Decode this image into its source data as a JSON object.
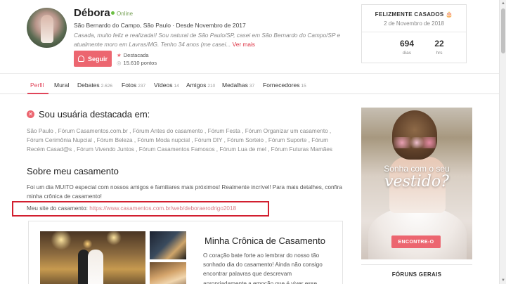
{
  "profile": {
    "name": "Débora",
    "status": "Online",
    "location": "São Bernardo do Campo, São Paulo · Desde Novembro de 2017",
    "bio": "Casada, muito feliz e realizada!! Sou natural de São Paulo/SP, casei em São Bernardo do Campo/SP e atualmente moro em Lavras/MG. Tenho 34 anos (me casei... ",
    "bio_more": "Ver mais",
    "follow_label": "Seguir",
    "featured_label": "Destacada",
    "points_label": "15.610 pontos"
  },
  "married_card": {
    "title": "FELIZMENTE CASADOS",
    "date": "2 de Novembro de 2018",
    "days_value": "694",
    "days_label": "dias",
    "hours_value": "22",
    "hours_label": "hrs"
  },
  "tabs": [
    {
      "label": "Perfil",
      "count": ""
    },
    {
      "label": "Mural",
      "count": ""
    },
    {
      "label": "Debates",
      "count": "2.626"
    },
    {
      "label": "Fotos",
      "count": "237"
    },
    {
      "label": "Vídeos",
      "count": "14"
    },
    {
      "label": "Amigos",
      "count": "210"
    },
    {
      "label": "Medalhas",
      "count": "37"
    },
    {
      "label": "Fornecedores",
      "count": "15"
    }
  ],
  "featured_section": {
    "title": "Sou usuária destacada em:",
    "forums": "São Paulo , Fórum Casamentos.com.br , Fórum Antes do casamento , Fórum Festa , Fórum Organizar um casamento , Fórum Cerimônia Nupcial , Fórum Beleza , Fórum Moda nupcial , Fórum DIY , Fórum Sorteio , Fórum Suporte , Fórum Recém Casad@s , Fórum Vivendo Juntos , Fórum Casamentos Famosos , Fórum Lua de mel , Fórum Futuras Mamães"
  },
  "about_section": {
    "title": "Sobre meu casamento",
    "text": "Foi um dia MUITO especial com nossos amigos e familiares mais próximos! Realmente incrível! Para mais detalhes, confira minha crônica de casamento!",
    "site_label": "Meu site do casamento: ",
    "site_url": "https://www.casamentos.com.br/web/deboraerodrigo2018"
  },
  "chronicle": {
    "title": "Minha Crônica de Casamento",
    "text": "O coração bate forte ao lembrar do nosso tão sonhado dia do casamento! Ainda não consigo encontrar palavras que descrevam apropriadamente a emoção que é viver esse momento. Tantos..."
  },
  "ad": {
    "line1": "Sonha com o seu",
    "line2": "vestido?",
    "cta": "ENCONTRE-O"
  },
  "sidebar": {
    "forums_general": "FÓRUNS GERAIS"
  },
  "colors": {
    "accent": "#ec6670",
    "highlight_box": "#d21f2f",
    "online": "#6cbf43"
  }
}
